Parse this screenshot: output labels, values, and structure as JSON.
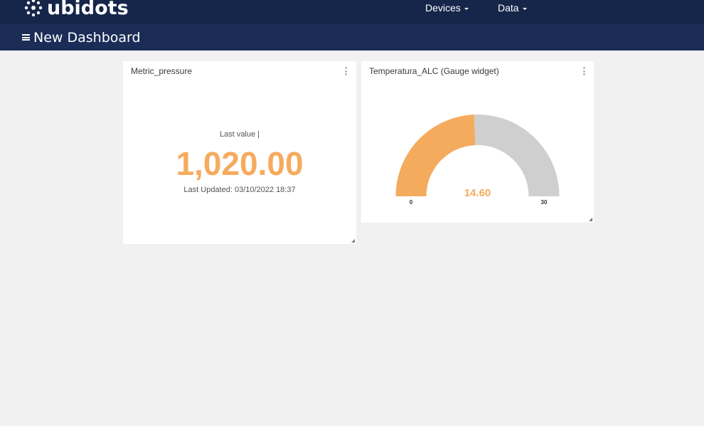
{
  "header": {
    "logo_text": "ubidots",
    "nav": [
      {
        "label": "Devices"
      },
      {
        "label": "Data"
      }
    ]
  },
  "dashboard": {
    "title": "New Dashboard"
  },
  "widgets": {
    "metric": {
      "title": "Metric_pressure",
      "last_value_label": "Last value |",
      "value": "1,020.00",
      "last_updated": "Last Updated: 03/10/2022 18:37"
    },
    "gauge": {
      "title": "Temperatura_ALC (Gauge widget)",
      "value": 14.6,
      "value_text": "14.60",
      "min": 0,
      "max": 30,
      "min_label": "0",
      "max_label": "30"
    }
  },
  "colors": {
    "topbar": "#16264a",
    "subbar": "#1b2c57",
    "accent": "#f5ab5e",
    "gauge_track": "#cfcfcf",
    "background": "#f1f1f1"
  }
}
